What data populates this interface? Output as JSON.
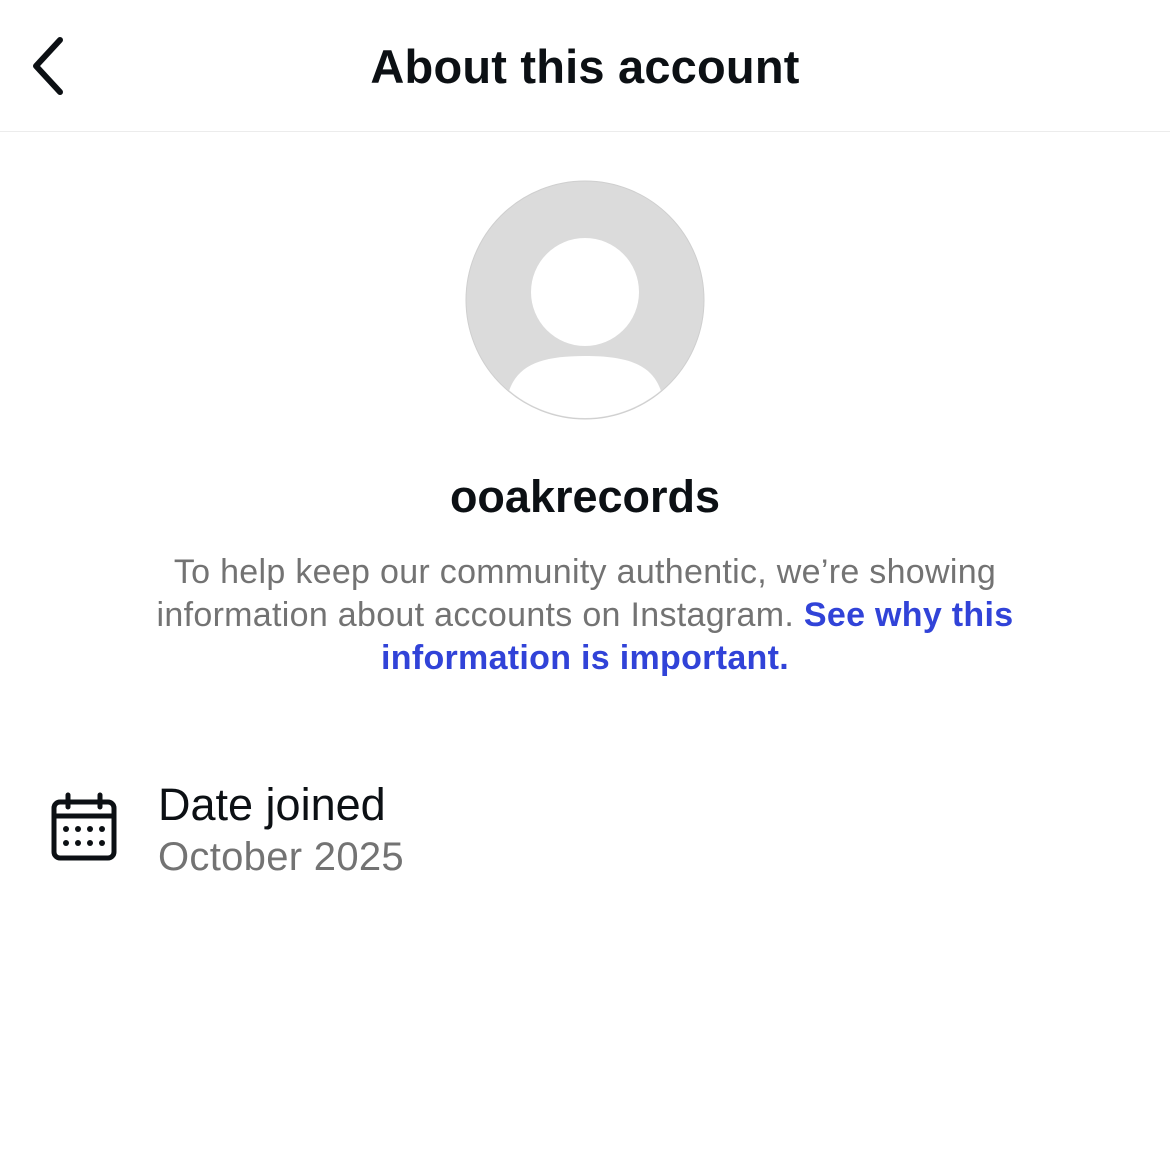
{
  "header": {
    "title": "About this account",
    "back_icon": "chevron-left-icon"
  },
  "profile": {
    "username": "ooakrecords",
    "avatar_icon": "default-avatar-icon"
  },
  "description": {
    "text": "To help keep our community authentic, we’re showing information about accounts on Instagram.",
    "link_text": "See why this information is important."
  },
  "details": {
    "date_joined": {
      "icon": "calendar-icon",
      "label": "Date joined",
      "value": "October 2025"
    }
  },
  "colors": {
    "link": "#3143d8",
    "secondary_text": "#737373",
    "avatar_background": "#dbdbdb"
  }
}
